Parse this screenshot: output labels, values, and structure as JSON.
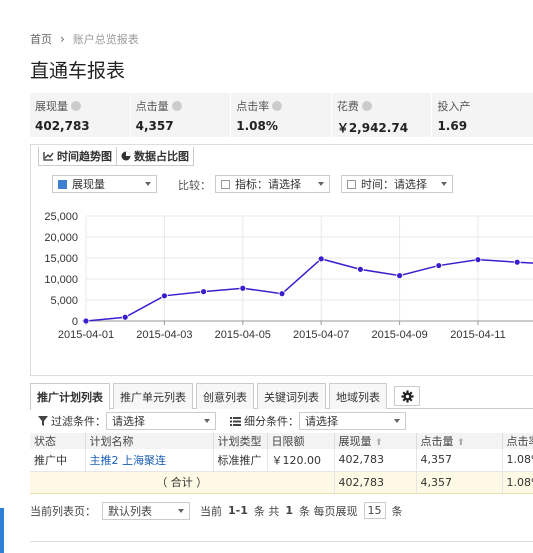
{
  "breadcrumb": {
    "home": "首页",
    "current": "账户总览报表"
  },
  "page_title": "直通车报表",
  "metrics": [
    {
      "label": "展现量",
      "value": "402,783"
    },
    {
      "label": "点击量",
      "value": "4,357"
    },
    {
      "label": "点击率",
      "value": "1.08%"
    },
    {
      "label": "花费",
      "value": "￥2,942.74"
    },
    {
      "label": "投入产",
      "value": "1.69"
    }
  ],
  "chart_tabs": {
    "trend": "时间趋势图",
    "proportion": "数据占比图"
  },
  "chart_controls": {
    "metric_select": "展现量",
    "compare_label": "比较：",
    "indicator_label": "指标：请选择",
    "time_label": "时间：请选择"
  },
  "chart_data": {
    "type": "line",
    "x": [
      "2015-04-01",
      "2015-04-02",
      "2015-04-03",
      "2015-04-04",
      "2015-04-05",
      "2015-04-06",
      "2015-04-07",
      "2015-04-08",
      "2015-04-09",
      "2015-04-10",
      "2015-04-11",
      "2015-04-12",
      "2015-04-13"
    ],
    "x_tick_labels": [
      "2015-04-01",
      "2015-04-03",
      "2015-04-05",
      "2015-04-07",
      "2015-04-09",
      "2015-04-11",
      "2"
    ],
    "y_tick_labels": [
      "25,000",
      "20,000",
      "15,000",
      "10,000",
      "5,000",
      "0"
    ],
    "series": [
      {
        "values": [
          0,
          900,
          6000,
          7000,
          7800,
          6500,
          14800,
          12300,
          10800,
          13200,
          14600,
          14000,
          13500
        ],
        "color": "#3b1fcf"
      }
    ],
    "ylim": [
      0,
      25000
    ],
    "grid": true
  },
  "table_tabs": [
    "推广计划列表",
    "推广单元列表",
    "创意列表",
    "关键词列表",
    "地域列表"
  ],
  "filter": {
    "condition_label": "过滤条件：",
    "condition_value": "请选择",
    "detail_label": "细分条件：",
    "detail_value": "请选择"
  },
  "table": {
    "headers": [
      "状态",
      "计划名称",
      "计划类型",
      "日限额",
      "展现量",
      "点击量",
      "点击率"
    ],
    "rows": [
      {
        "status": "推广中",
        "name": "主推2 上海聚连",
        "type": "标准推广",
        "budget": "￥120.00",
        "impressions": "402,783",
        "clicks": "4,357",
        "ctr": "1.08%"
      }
    ],
    "total": {
      "label": "（ 合计 ）",
      "impressions": "402,783",
      "clicks": "4,357",
      "ctr": "1.08%"
    }
  },
  "pager": {
    "current_label": "当前列表页：",
    "list_select": "默认列表",
    "info_prefix": "当前",
    "range": "1-1",
    "info_mid": "条  共",
    "total_count": "1",
    "info_suffix": "条  每页展现",
    "per_page": "15",
    "unit": "条"
  }
}
